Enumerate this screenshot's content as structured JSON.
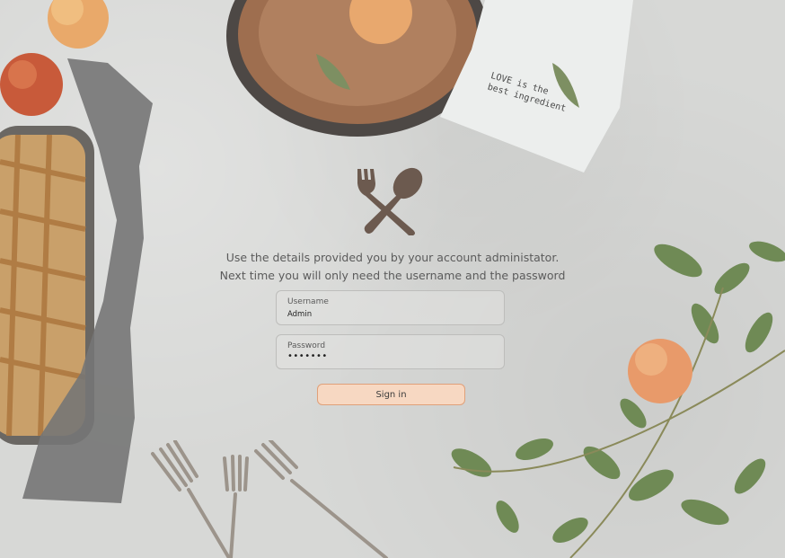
{
  "background": {
    "napkin_text_line1": "LOVE is the",
    "napkin_text_line2": "best ingredient"
  },
  "logo": {
    "icon": "fork-and-spoon-icon"
  },
  "instructions": {
    "line1": "Use the details provided you by your account administator.",
    "line2": "Next time you will only need the username and the password"
  },
  "form": {
    "username_label": "Username",
    "username_value": "Admin",
    "password_label": "Password",
    "password_value": "•••••••",
    "sign_in_label": "Sign in"
  },
  "colors": {
    "accent_fill": "#f7d8c2",
    "accent_border": "#e0a079",
    "logo_brown": "#6c5a4f"
  }
}
